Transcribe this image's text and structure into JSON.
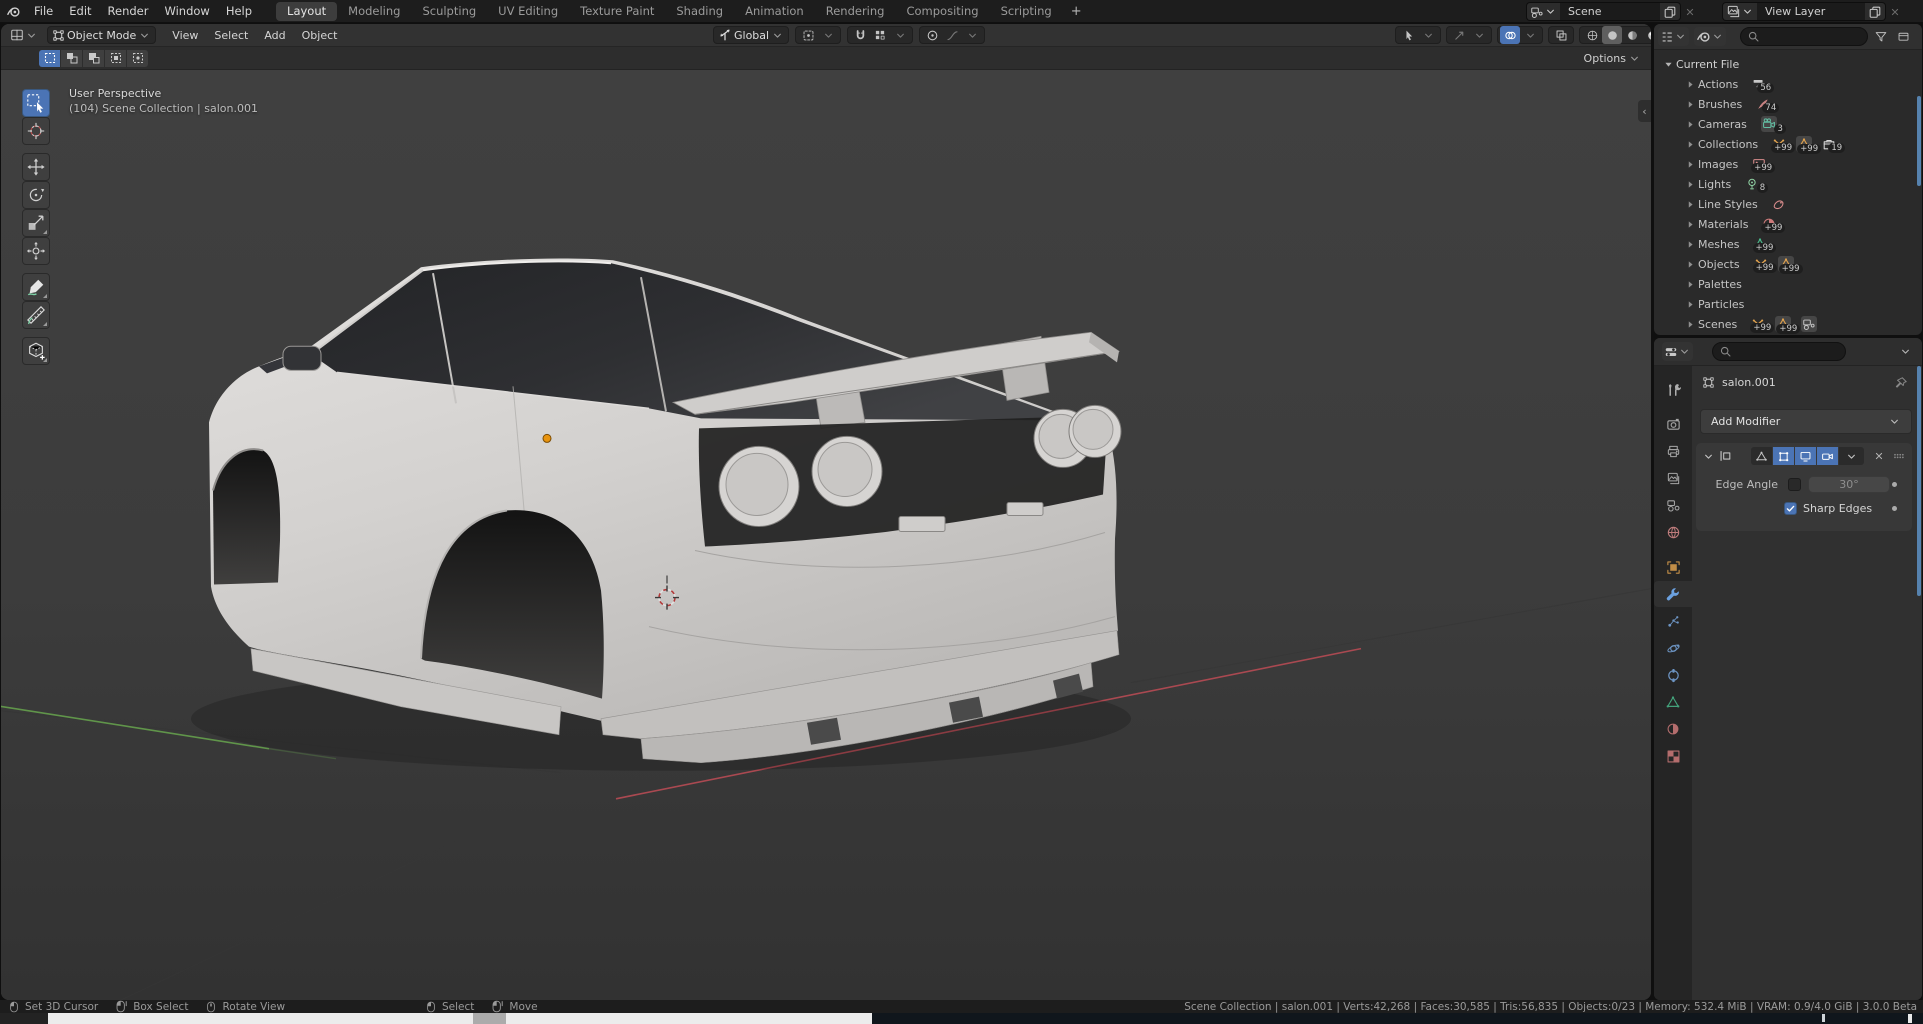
{
  "topbar": {
    "menus": [
      "File",
      "Edit",
      "Render",
      "Window",
      "Help"
    ],
    "workspaces": [
      "Layout",
      "Modeling",
      "Sculpting",
      "UV Editing",
      "Texture Paint",
      "Shading",
      "Animation",
      "Rendering",
      "Compositing",
      "Scripting"
    ],
    "active_workspace": "Layout",
    "add_workspace_label": "+",
    "scene_selector": {
      "label": "Scene"
    },
    "view_layer_selector": {
      "label": "View Layer"
    }
  },
  "viewport_header": {
    "mode": "Object Mode",
    "menus": [
      "View",
      "Select",
      "Add",
      "Object"
    ],
    "orientation": "Global",
    "options_label": "Options"
  },
  "tool_settings": {
    "select_modes": [
      "set",
      "extend",
      "subtract",
      "invert",
      "intersect"
    ],
    "active_mode": "set"
  },
  "toolbar_tools": [
    "select-box",
    "cursor",
    "move",
    "rotate",
    "scale",
    "transform",
    "annotate",
    "measure",
    "add-cube"
  ],
  "viewport": {
    "perspective_label": "User Perspective",
    "collection_label": "(104) Scene Collection | salon.001"
  },
  "outliner": {
    "root": "Current File",
    "items": [
      {
        "label": "Actions",
        "badges": [
          {
            "icon": "action",
            "color": "#c8c8c8",
            "count": "56",
            "boxed": false
          }
        ]
      },
      {
        "label": "Brushes",
        "badges": [
          {
            "icon": "brush",
            "color": "#d98c8c",
            "count": "74",
            "boxed": false
          }
        ]
      },
      {
        "label": "Cameras",
        "badges": [
          {
            "icon": "camera",
            "color": "#63bfa4",
            "count": "3",
            "boxed": true
          }
        ]
      },
      {
        "label": "Collections",
        "badges": [
          {
            "icon": "empty-axes",
            "color": "#dfa14d",
            "count": "+99",
            "boxed": false
          },
          {
            "icon": "mesh-tri",
            "color": "#dfa14d",
            "count": "+99",
            "boxed": true
          },
          {
            "icon": "collection",
            "color": "#d8d8d8",
            "count": "19",
            "boxed": false
          }
        ]
      },
      {
        "label": "Images",
        "badges": [
          {
            "icon": "image",
            "color": "#d98c8c",
            "count": "+99",
            "boxed": false
          }
        ]
      },
      {
        "label": "Lights",
        "badges": [
          {
            "icon": "light",
            "color": "#8fd0a2",
            "count": "8",
            "boxed": false
          }
        ]
      },
      {
        "label": "Line Styles",
        "badges": [
          {
            "icon": "linestyle",
            "color": "#d98c8c",
            "count": "",
            "boxed": false
          }
        ]
      },
      {
        "label": "Materials",
        "badges": [
          {
            "icon": "material",
            "color": "#cd7a7a",
            "count": "+99",
            "boxed": false
          }
        ]
      },
      {
        "label": "Meshes",
        "badges": [
          {
            "icon": "mesh-tri",
            "color": "#49b88a",
            "count": "+99",
            "boxed": false
          }
        ]
      },
      {
        "label": "Objects",
        "badges": [
          {
            "icon": "empty-axes",
            "color": "#dfa14d",
            "count": "+99",
            "boxed": false
          },
          {
            "icon": "mesh-tri",
            "color": "#dfa14d",
            "count": "+99",
            "boxed": true
          }
        ]
      },
      {
        "label": "Palettes",
        "badges": []
      },
      {
        "label": "Particles",
        "badges": []
      },
      {
        "label": "Scenes",
        "badges": [
          {
            "icon": "empty-axes",
            "color": "#dfa14d",
            "count": "+99",
            "boxed": false
          },
          {
            "icon": "mesh-tri",
            "color": "#dfa14d",
            "count": "+99",
            "boxed": true
          },
          {
            "icon": "scene",
            "color": "#c8c8c8",
            "count": "",
            "boxed": true
          }
        ]
      }
    ]
  },
  "properties": {
    "pinned_object": "salon.001",
    "add_modifier_label": "Add Modifier",
    "tabs": [
      "tool",
      "render",
      "output",
      "view-layer",
      "scene",
      "world",
      "object",
      "modifiers",
      "particles",
      "physics",
      "constraints",
      "object-data",
      "material",
      "texture"
    ],
    "active_tab": "modifiers",
    "modifier_panel": {
      "edge_angle_label": "Edge Angle",
      "edge_angle_value": "30°",
      "sharp_edges_label": "Sharp Edges",
      "sharp_edges_checked": true
    }
  },
  "status_bar": {
    "left_hints": [
      {
        "icon": "mouse-left",
        "label": "Set 3D Cursor"
      },
      {
        "icon": "mouse-left-drag",
        "label": "Box Select"
      },
      {
        "icon": "mouse-middle",
        "label": "Rotate View"
      }
    ],
    "center_hints": [
      {
        "icon": "mouse-left",
        "label": "Select"
      },
      {
        "icon": "mouse-left-drag",
        "label": "Move"
      }
    ],
    "stats": "Scene Collection | salon.001 | Verts:42,268 | Faces:30,585 | Tris:56,835 | Objects:0/23 | Memory: 532.4 MiB | VRAM: 0.9/4.0 GiB | 3.0.0 Beta"
  },
  "colors": {
    "accent_blue": "#4b74b5",
    "scrollbar_blue": "#5682ae",
    "axis_x_red": "#b04a52",
    "axis_y_green": "#65a04c",
    "origin_orange": "#e8940f"
  }
}
